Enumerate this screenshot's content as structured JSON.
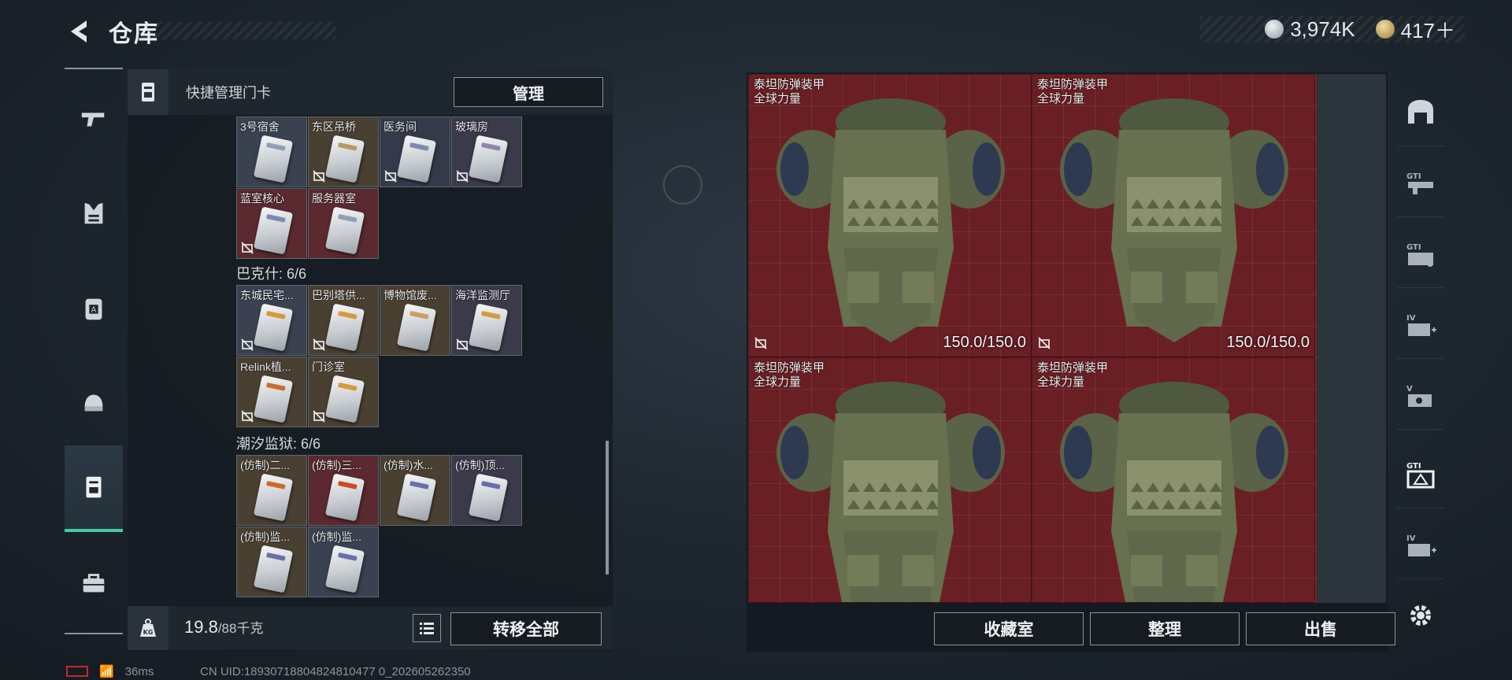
{
  "header": {
    "title": "仓库"
  },
  "currency": [
    {
      "value": "3,974K",
      "color": "#c9cfd4",
      "icon": "silver-coin-icon"
    },
    {
      "value": "417＋",
      "color": "#c8a45c",
      "icon": "gold-coin-icon"
    }
  ],
  "left_rail": {
    "items": [
      {
        "name": "weapons",
        "icon": "pistol-icon"
      },
      {
        "name": "armor",
        "icon": "vest-icon"
      },
      {
        "name": "backpack",
        "icon": "backpack-icon"
      },
      {
        "name": "helmet",
        "icon": "helmet-icon"
      },
      {
        "name": "keycards",
        "icon": "keycard-icon",
        "active": true
      },
      {
        "name": "toolbox",
        "icon": "toolbox-icon"
      }
    ]
  },
  "left_panel": {
    "header_label": "快捷管理门卡",
    "manage_button": "管理",
    "groups": [
      {
        "title": "",
        "cards": [
          {
            "name": "3号宿舍",
            "bg": "#3a4150",
            "no_trade": false,
            "stripe": "#8fa0b8"
          },
          {
            "name": "东区吊桥",
            "bg": "#4a4032",
            "no_trade": true,
            "stripe": "#b59a66"
          },
          {
            "name": "医务间",
            "bg": "#353a4b",
            "no_trade": true,
            "stripe": "#7d8bb0"
          },
          {
            "name": "玻璃房",
            "bg": "#3b3a4b",
            "no_trade": true,
            "stripe": "#8f86a8"
          },
          {
            "name": "蓝室核心",
            "bg": "#5a2a30",
            "no_trade": true,
            "stripe": "#7d8bb0"
          },
          {
            "name": "服务器室",
            "bg": "#5a2a30",
            "no_trade": false,
            "stripe": "#8fa0b8"
          }
        ]
      },
      {
        "title": "巴克什: 6/6",
        "cards": [
          {
            "name": "东城民宅...",
            "bg": "#3a4150",
            "no_trade": true,
            "stripe": "#d59a3c"
          },
          {
            "name": "巴别塔供...",
            "bg": "#4a4032",
            "no_trade": true,
            "stripe": "#d59a3c"
          },
          {
            "name": "博物馆废...",
            "bg": "#4a4032",
            "no_trade": false,
            "stripe": "#c9a062"
          },
          {
            "name": "海洋监测厅",
            "bg": "#3b3a4b",
            "no_trade": true,
            "stripe": "#d59a3c"
          },
          {
            "name": "Relink植...",
            "bg": "#4a4032",
            "no_trade": true,
            "stripe": "#c96e2c"
          },
          {
            "name": "门诊室",
            "bg": "#4a4032",
            "no_trade": true,
            "stripe": "#d59a3c"
          }
        ]
      },
      {
        "title": "潮汐监狱: 6/6",
        "cards": [
          {
            "name": "(仿制)二...",
            "bg": "#4a4032",
            "no_trade": false,
            "stripe": "#d06a2a"
          },
          {
            "name": "(仿制)三...",
            "bg": "#5a2a30",
            "no_trade": false,
            "stripe": "#d04a1e"
          },
          {
            "name": "(仿制)水...",
            "bg": "#4a4032",
            "no_trade": false,
            "stripe": "#6a6fa8"
          },
          {
            "name": "(仿制)顶...",
            "bg": "#3b3a4b",
            "no_trade": false,
            "stripe": "#6a6fa8"
          },
          {
            "name": "(仿制)监...",
            "bg": "#4a4032",
            "no_trade": false,
            "stripe": "#6a6fa8"
          },
          {
            "name": "(仿制)监...",
            "bg": "#3a4150",
            "no_trade": false,
            "stripe": "#6a6fa8"
          }
        ]
      }
    ],
    "weight_value": "19.8",
    "weight_capacity": "/88千克",
    "transfer_all_button": "转移全部"
  },
  "right_panel": {
    "items": [
      {
        "name": "泰坦防弹装甲",
        "subtitle": "全球力量",
        "durability": "150.0/150.0",
        "show_durability": true
      },
      {
        "name": "泰坦防弹装甲",
        "subtitle": "全球力量",
        "durability": "150.0/150.0",
        "show_durability": true
      },
      {
        "name": "泰坦防弹装甲",
        "subtitle": "全球力量",
        "durability": "",
        "show_durability": false
      },
      {
        "name": "泰坦防弹装甲",
        "subtitle": "全球力量",
        "durability": "",
        "show_durability": false
      }
    ],
    "buttons": {
      "collection": "收藏室",
      "sort": "整理",
      "sell": "出售"
    }
  },
  "right_rail": {
    "items": [
      {
        "name": "container",
        "icon": "bunker-icon"
      },
      {
        "name": "gti-1",
        "icon": "gti-rifle-icon"
      },
      {
        "name": "gti-2",
        "icon": "gti-case-icon"
      },
      {
        "name": "iv-1",
        "icon": "iv-medkit-icon"
      },
      {
        "name": "v",
        "icon": "v-gear-icon"
      },
      {
        "name": "gti-3",
        "icon": "gti-triangle-icon",
        "active": true
      },
      {
        "name": "iv-2",
        "icon": "iv-case-icon"
      }
    ]
  },
  "status": {
    "ping": "36ms",
    "uid": "CN UID:18930718804824810477 0_202605262350"
  }
}
